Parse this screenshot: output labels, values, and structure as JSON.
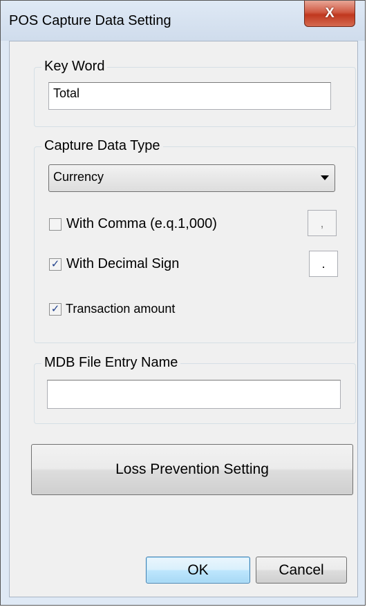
{
  "window": {
    "title": "POS Capture Data Setting",
    "close_icon": "X"
  },
  "keyword_group": {
    "title": "Key Word",
    "value": "Total"
  },
  "capture_group": {
    "title": "Capture Data Type",
    "selected": "Currency",
    "with_comma": {
      "label": "With Comma (e.q.1,000)",
      "checked": false,
      "separator": ","
    },
    "with_decimal": {
      "label": "With Decimal Sign",
      "checked": true,
      "separator": "."
    },
    "transaction_amount": {
      "label": "Transaction amount",
      "checked": true
    },
    "check_mark": "✓"
  },
  "mdb_group": {
    "title": "MDB File Entry Name",
    "value": ""
  },
  "buttons": {
    "loss_prevention": "Loss Prevention Setting",
    "ok": "OK",
    "cancel": "Cancel"
  }
}
